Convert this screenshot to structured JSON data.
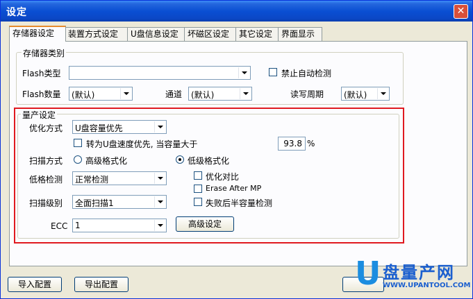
{
  "window": {
    "title": "设定",
    "close_glyph": "✕"
  },
  "tabs": [
    {
      "label": "存储器设定",
      "active": true
    },
    {
      "label": "装置方式设定",
      "active": false
    },
    {
      "label": "U盘信息设定",
      "active": false
    },
    {
      "label": "坏磁区设定",
      "active": false
    },
    {
      "label": "其它设定",
      "active": false
    },
    {
      "label": "界面显示",
      "active": false
    }
  ],
  "storage_group": {
    "title": "存储器类别",
    "flash_type_label": "Flash类型",
    "flash_type_value": "",
    "auto_detect_label": "禁止自动检测",
    "flash_count_label": "Flash数量",
    "flash_count_value": "(默认)",
    "channel_label": "通道",
    "channel_value": "(默认)",
    "rw_cycle_label": "读写周期",
    "rw_cycle_value": "(默认)"
  },
  "mp_group": {
    "title": "量产设定",
    "optimize_label": "优化方式",
    "optimize_value": "U盘容量优先",
    "speed_priority_label": "转为U盘速度优先, 当容量大于",
    "speed_priority_value": "93.8",
    "percent": "%",
    "scan_mode_label": "扫描方式",
    "high_format_label": "高级格式化",
    "low_format_label": "低级格式化",
    "low_check_label": "低格检测",
    "low_check_value": "正常检测",
    "optimize_compare_label": "优化对比",
    "erase_after_mp_label": "Erase After MP",
    "fail_half_label": "失败后半容量检测",
    "scan_level_label": "扫描级别",
    "scan_level_value": "全面扫描1",
    "ecc_label": "ECC",
    "ecc_value": "1",
    "advanced_button": "高级设定"
  },
  "footer": {
    "import_button": "导入配置",
    "export_button": "导出配置"
  },
  "watermark": {
    "mark": "U",
    "name": "盘量产网",
    "url": "WWW.UPANTOOL.COM"
  },
  "colors": {
    "titlebar": "#0a4fd3",
    "highlight_box": "#e0191f",
    "watermark": "#1b5fcf"
  }
}
